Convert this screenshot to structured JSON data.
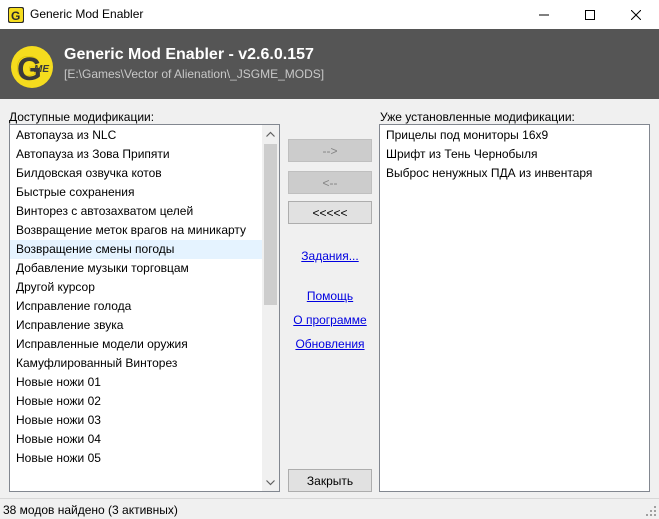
{
  "window": {
    "title": "Generic Mod Enabler",
    "icon": "gme-app-icon"
  },
  "banner": {
    "logo_letter": "G",
    "logo_sub": "ME",
    "title": "Generic Mod Enabler - v2.6.0.157",
    "path": "[E:\\Games\\Vector of Alienation\\_JSGME_MODS]",
    "background": "#555555",
    "logo_color": "#f5dc1e"
  },
  "available": {
    "label": "Доступные модификации:",
    "items": [
      "Автопауза из NLC",
      "Автопауза из Зова Припяти",
      "Билдовская озвучка котов",
      "Быстрые сохранения",
      "Винторез с автозахватом целей",
      "Возвращение меток врагов на миникарту",
      "Возвращение смены погоды",
      "Добавление музыки торговцам",
      "Другой курсор",
      "Исправление голода",
      "Исправление звука",
      "Исправленные модели оружия",
      "Камуфлированный Винторез",
      "Новые ножи 01",
      "Новые ножи 02",
      "Новые ножи 03",
      "Новые ножи 04",
      "Новые ножи 05"
    ],
    "selected_item": "Возвращение смены погоды"
  },
  "installed": {
    "label": "Уже установленные модификации:",
    "items": [
      "Прицелы под мониторы 16x9",
      "Шрифт из Тень Чернобыля",
      "Выброс ненужных ПДА из инвентаря"
    ]
  },
  "buttons": {
    "add": "-->",
    "remove": "<--",
    "remove_all": "<<<<<",
    "close": "Закрыть"
  },
  "links": {
    "tasks": "Задания...",
    "help": "Помощь",
    "about": "О программе",
    "updates": "Обновления"
  },
  "status": {
    "text": "38 модов найдено (3 активных)"
  }
}
